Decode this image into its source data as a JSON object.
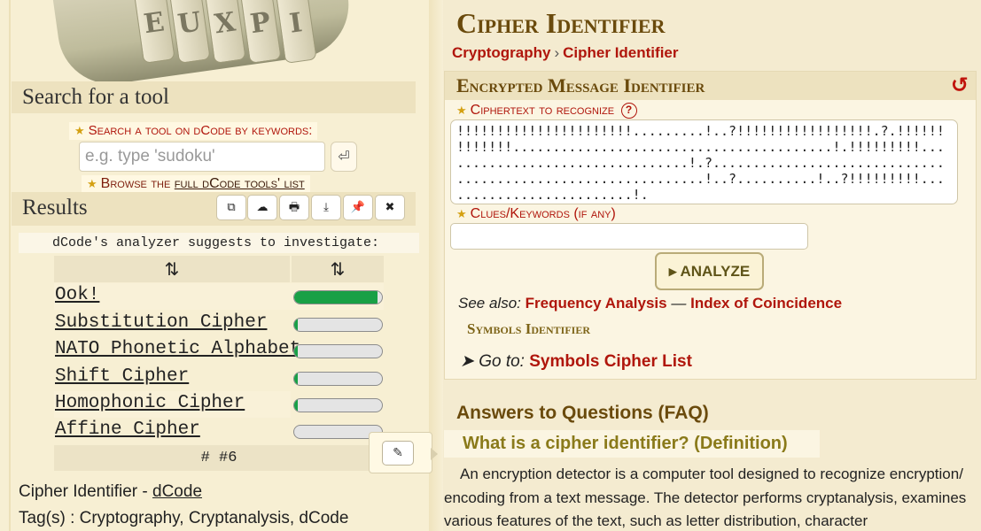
{
  "logo": {
    "letters": [
      "E",
      "U",
      "X",
      "P",
      "I"
    ]
  },
  "search": {
    "heading": "Search for a tool",
    "label": "Search a tool on dCode by keywords:",
    "placeholder": "e.g. type 'sudoku'",
    "go_icon": "enter-icon",
    "browse_prefix": "Browse the",
    "browse_link": "full dCode tools' list"
  },
  "results": {
    "heading": "Results",
    "toolbar": [
      {
        "name": "copy-button",
        "icon": "⧉"
      },
      {
        "name": "cloud-button",
        "icon": "☁"
      },
      {
        "name": "print-button",
        "icon": "🖶"
      },
      {
        "name": "download-button",
        "icon": "⤓"
      },
      {
        "name": "pin-button",
        "icon": "📌"
      },
      {
        "name": "close-button",
        "icon": "✖"
      }
    ],
    "suggest": "dCode's analyzer suggests to investigate:",
    "sort_name": "⇅",
    "sort_score": "⇅",
    "items": [
      {
        "name": "Ook!",
        "score": 0.95
      },
      {
        "name": "Substitution Cipher",
        "score": 0.04
      },
      {
        "name": "NATO Phonetic Alphabet",
        "score": 0.04
      },
      {
        "name": "Shift Cipher",
        "score": 0.03
      },
      {
        "name": "Homophonic Cipher",
        "score": 0.03
      },
      {
        "name": "Affine Cipher",
        "score": 0.0
      }
    ],
    "page": "# #6",
    "edit_icon": "✎"
  },
  "footer_left": {
    "ci_text": "Cipher Identifier - ",
    "ci_link": "dCode",
    "tags": "Tag(s) : Cryptography, Cryptanalysis, dCode"
  },
  "main": {
    "title": "Cipher Identifier",
    "breadcrumb": [
      "Cryptography",
      "Cipher Identifier"
    ],
    "tool_heading": "Encrypted Message Identifier",
    "reset_icon": "↺",
    "ciphertext_label": "Ciphertext to recognize",
    "help_icon": "?",
    "ciphertext_value": "!!!!!!!!!!!!!!!!!!!!!!.........!..?!!!!!!!!!!!!!!!!!.?.!!!!!!!!!!!!!........................................!.!!!!!!!!!................................!.?............................................................!..?..........!..?!!!!!!!!!.........................!.",
    "clues_label": "Clues/Keywords (if any)",
    "analyze": "▸ ANALYZE",
    "see_also": "See also:",
    "see_also_links": [
      "Frequency Analysis",
      "Index of Coincidence"
    ],
    "see_also_sep": "—",
    "symbols_identifier": "Symbols Identifier",
    "goto": "➤ Go to:",
    "goto_link": "Symbols Cipher List"
  },
  "faq": {
    "title": "Answers to Questions (FAQ)",
    "question": "What is a cipher identifier? (Definition)",
    "answer": "An encryption detector is a computer tool designed to recognize encryption/ encoding from a text message. The detector performs cryptanalysis, examines various features of the text, such as letter distribution, character"
  },
  "colors": {
    "accent": "#b0160c",
    "brand": "#6a4a0c",
    "bar_fill": "#19a046"
  }
}
